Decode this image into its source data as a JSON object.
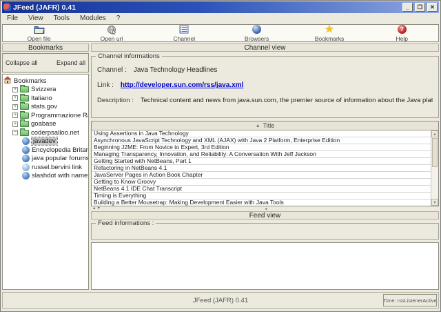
{
  "window": {
    "title": "JFeed (JAFR) 0.41"
  },
  "glyphs": {
    "minimize": "_",
    "maximize": "❐",
    "close": "✕",
    "sort": "▲",
    "up": "▲",
    "down": "▼",
    "plus": "+",
    "minus": "−",
    "help_mark": "?"
  },
  "menu": [
    "File",
    "View",
    "Tools",
    "Modules",
    "?"
  ],
  "toolbar": [
    {
      "label": "Open file",
      "icon": "open-file-icon"
    },
    {
      "label": "Open url",
      "icon": "open-url-icon"
    },
    {
      "label": "Channel",
      "icon": "channel-icon"
    },
    {
      "label": "Browsers",
      "icon": "browsers-icon"
    },
    {
      "label": "Bookmarks",
      "icon": "bookmarks-icon"
    },
    {
      "label": "Help",
      "icon": "help-icon"
    }
  ],
  "sidebar": {
    "header": "Bookmarks",
    "collapse_all": "Collapse all",
    "expand_all": "Expand all",
    "root": "Bookmarks",
    "folders": [
      "Svizzera",
      "Italiano",
      "stats.gov",
      "Programmazione Rawel",
      "goabase",
      "coderpsalloo.net"
    ],
    "feeds": [
      "javadev",
      "Encyclopedia Britannica",
      "java popular forums",
      "russel.bervini link",
      "slashdot with namespace"
    ],
    "selected_feed": "javadev"
  },
  "channel_view": {
    "header": "Channel view",
    "group_title": "Channel informations",
    "channel_label": "Channel :",
    "channel_value": "Java Technology Headlines",
    "link_label": "Link :",
    "link_value": "http://developer.sun.com/rss/java.xml",
    "description_label": "Description :",
    "description_value": "Technical content and news from java.sun.com, the premier source of information about the Java platform."
  },
  "articles": {
    "column_header": "Title",
    "rows": [
      "Using Assertions in Java Technology",
      "Asynchronous JavaScript Technology and XML (AJAX) with Java 2 Platform, Enterprise Edition",
      "Beginning J2ME: From Novice to Expert, 3rd Edition",
      "Managing Transparency, Innovation, and Reliability: A Conversation With Jeff Jackson",
      "Getting Started with NetBeans, Part 1",
      "Refactoring in NetBeans 4.1",
      "JavaServer Pages in Action Book Chapter",
      "Getting to Know Groovy",
      "NetBeans 4.1 IDE Chat Transcript",
      "Timing is Everything",
      "Building a Better Mousetrap: Making Development Easier with Java Tools"
    ]
  },
  "feed_view": {
    "header": "Feed view",
    "group_title": "Feed informations :"
  },
  "statusbar": {
    "center": "JFeed (JAFR) 0.41",
    "right": "Time: rssListenerActive"
  },
  "colors": {
    "titlebar_start": "#16339b",
    "titlebar_end": "#8fa8e0",
    "window_bg": "#eceade",
    "link": "#0000cc",
    "selection_bg": "#c8c8c8",
    "folder_green": "#6dbd6d",
    "star_yellow": "#f5c518",
    "help_red": "#b01818"
  }
}
